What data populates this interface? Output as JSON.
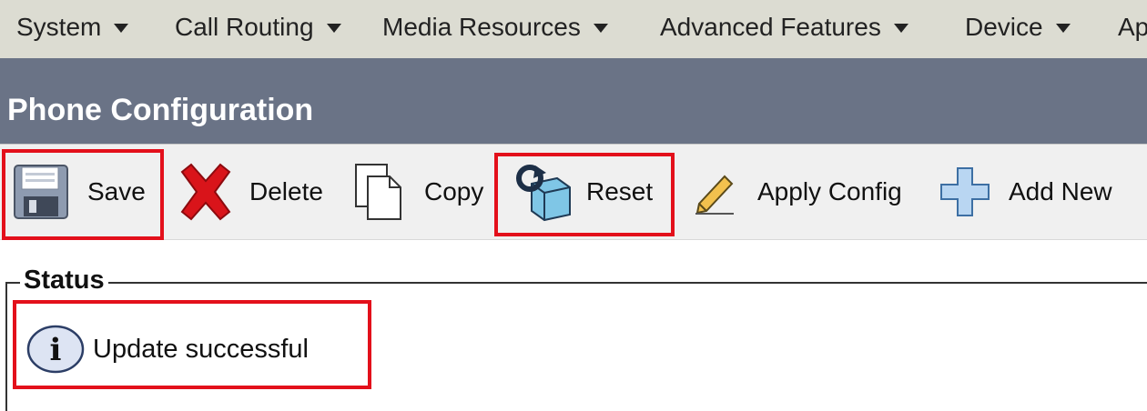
{
  "menubar": {
    "items": [
      {
        "label": "System"
      },
      {
        "label": "Call Routing"
      },
      {
        "label": "Media Resources"
      },
      {
        "label": "Advanced Features"
      },
      {
        "label": "Device"
      },
      {
        "label": "Ap"
      }
    ]
  },
  "page": {
    "title": "Phone Configuration"
  },
  "toolbar": {
    "save": "Save",
    "delete": "Delete",
    "copy": "Copy",
    "reset": "Reset",
    "apply_config": "Apply Config",
    "add_new": "Add New"
  },
  "status": {
    "legend": "Status",
    "message": "Update successful"
  },
  "colors": {
    "menubar_bg": "#dcdcd2",
    "titlebar_bg": "#6a7386",
    "highlight": "#e3101b",
    "delete_red": "#d9141a"
  }
}
